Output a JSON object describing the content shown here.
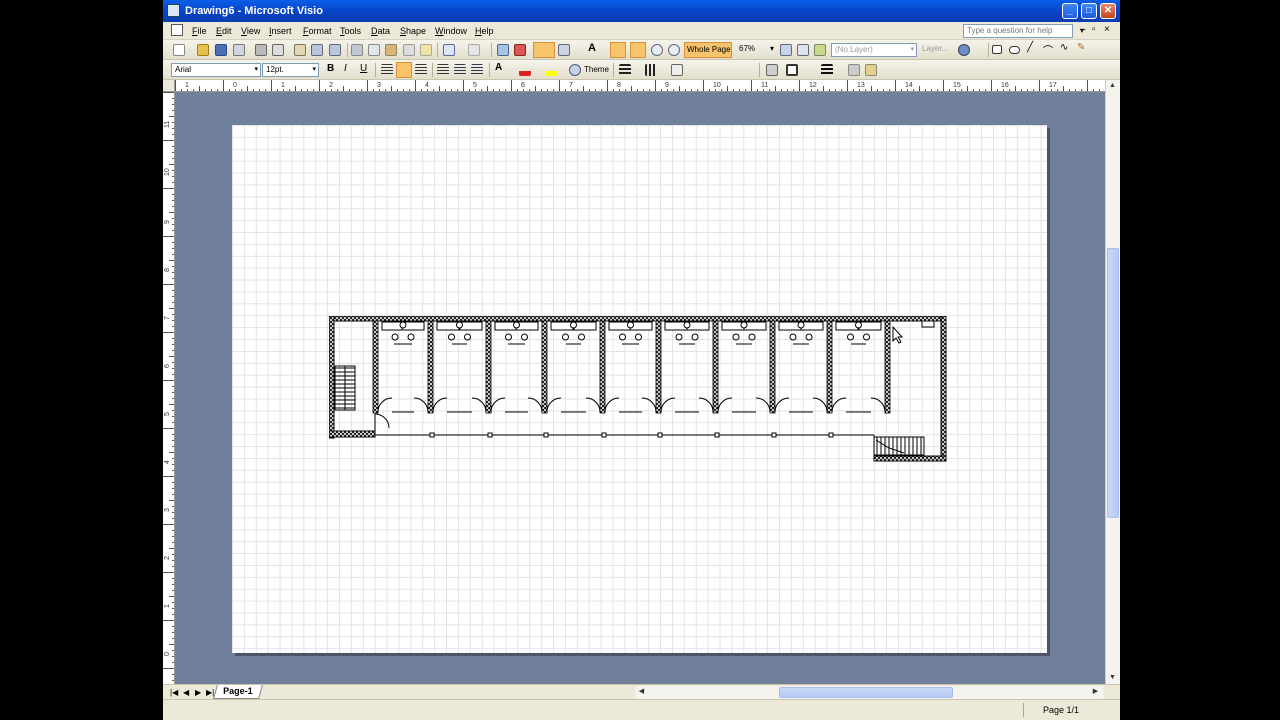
{
  "window": {
    "title": "Drawing6 - Microsoft Visio"
  },
  "menu": [
    "File",
    "Edit",
    "View",
    "Insert",
    "Format",
    "Tools",
    "Data",
    "Shape",
    "Window",
    "Help"
  ],
  "help": {
    "placeholder": "Type a question for help"
  },
  "toolbar1": {
    "whole_page": "Whole Page",
    "zoom": "67%",
    "layer": "(No Layer)",
    "layers_label": "Layer..."
  },
  "toolbar2": {
    "font": "Arial",
    "size": "12pt.",
    "bold": "B",
    "italic": "I",
    "underline": "U",
    "theme": "Theme",
    "font_color_glyph": "A"
  },
  "hruler": {
    "labels": [
      "1",
      "0",
      "1",
      "2",
      "3",
      "4",
      "5",
      "6",
      "7",
      "8",
      "9",
      "10",
      "11",
      "12",
      "13",
      "14",
      "15",
      "16",
      "17"
    ]
  },
  "vruler": {
    "labels": [
      "11",
      "10",
      "9",
      "8",
      "7",
      "6",
      "5",
      "4",
      "3",
      "2",
      "1",
      "0"
    ]
  },
  "tabs": {
    "page": "Page-1"
  },
  "status": {
    "page": "Page 1/1"
  }
}
